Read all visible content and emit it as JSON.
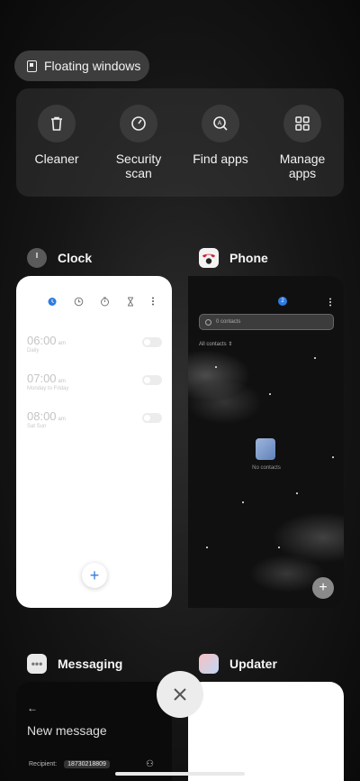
{
  "floating_windows": {
    "label": "Floating windows"
  },
  "tools": [
    {
      "label_lines": [
        "Cleaner"
      ],
      "icon": "trash-icon"
    },
    {
      "label_lines": [
        "Security",
        "scan"
      ],
      "icon": "gauge-icon"
    },
    {
      "label_lines": [
        "Find apps"
      ],
      "icon": "app-search-icon"
    },
    {
      "label_lines": [
        "Manage",
        "apps"
      ],
      "icon": "grid-icon"
    }
  ],
  "apps": {
    "clock": {
      "name": "Clock",
      "alarms": [
        {
          "time": "06:00",
          "ampm": "am",
          "repeat": "Daily"
        },
        {
          "time": "07:00",
          "ampm": "am",
          "repeat": "Monday to Friday"
        },
        {
          "time": "08:00",
          "ampm": "am",
          "repeat": "Sat Sun"
        }
      ],
      "add_label": "+"
    },
    "phone": {
      "name": "Phone",
      "badge": "2",
      "search_placeholder": "0 contacts",
      "filter": "All contacts",
      "empty_text": "No contacts",
      "add_label": "+"
    },
    "messaging": {
      "name": "Messaging",
      "title": "New message",
      "recipient_label": "Recipient:",
      "recipient_value": "18730218809"
    },
    "updater": {
      "name": "Updater"
    }
  },
  "close_label": "×",
  "colors": {
    "accent": "#2f7be0",
    "card_bg": "#ffffff",
    "pill_bg": "#3d3d3d"
  }
}
